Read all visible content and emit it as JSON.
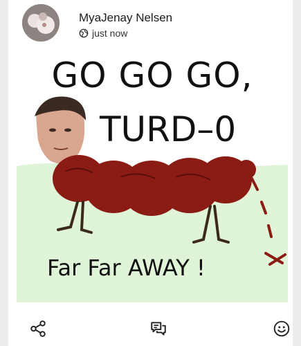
{
  "post": {
    "author": "MyaJenay Nelsen",
    "timestamp": "just now",
    "visibility_icon": "globe-icon",
    "image": {
      "line1": "GO GO GO,",
      "line2": "TURD–0",
      "line3": "Far Far AWAY !"
    }
  },
  "actions": {
    "share_icon": "share-icon",
    "comment_icon": "comment-icon",
    "react_icon": "smiley-icon"
  },
  "colors": {
    "turd": "#8a1c14",
    "grass": "#dff3d6",
    "text": "#111111"
  }
}
